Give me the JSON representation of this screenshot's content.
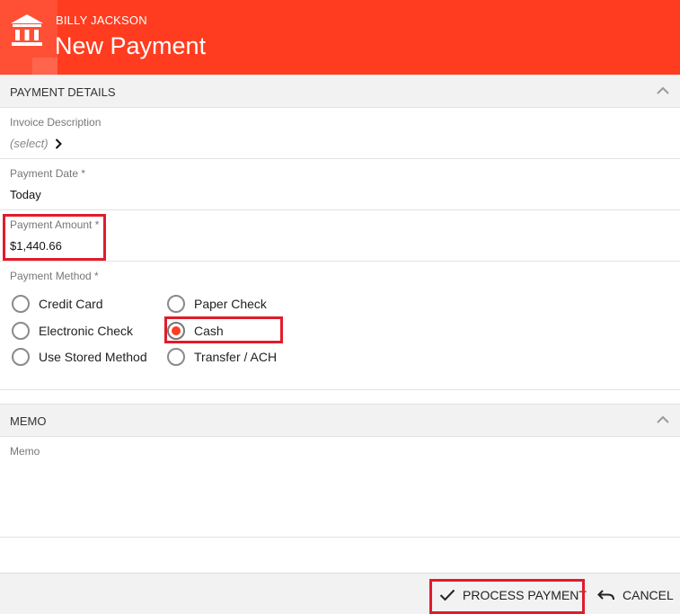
{
  "header": {
    "subtitle": "BILLY JACKSON",
    "title": "New Payment",
    "logo_icon": "bank-icon",
    "accent": "#ff3c1f"
  },
  "payment_details": {
    "section_label": "PAYMENT DETAILS",
    "invoice": {
      "label": "Invoice Description",
      "value": "(select)"
    },
    "date": {
      "label": "Payment Date *",
      "value": "Today"
    },
    "amount": {
      "label": "Payment Amount *",
      "value": "$1,440.66"
    },
    "method": {
      "label": "Payment Method *",
      "options": [
        "Credit Card",
        "Electronic Check",
        "Use Stored Method",
        "Paper Check",
        "Cash",
        "Transfer / ACH"
      ],
      "selected": "Cash"
    }
  },
  "memo": {
    "section_label": "MEMO",
    "field_label": "Memo",
    "value": ""
  },
  "footer": {
    "process_label": "PROCESS PAYMENT",
    "cancel_label": "CANCEL"
  },
  "colors": {
    "accent": "#ff3c1f",
    "highlight": "#e21b2b"
  }
}
